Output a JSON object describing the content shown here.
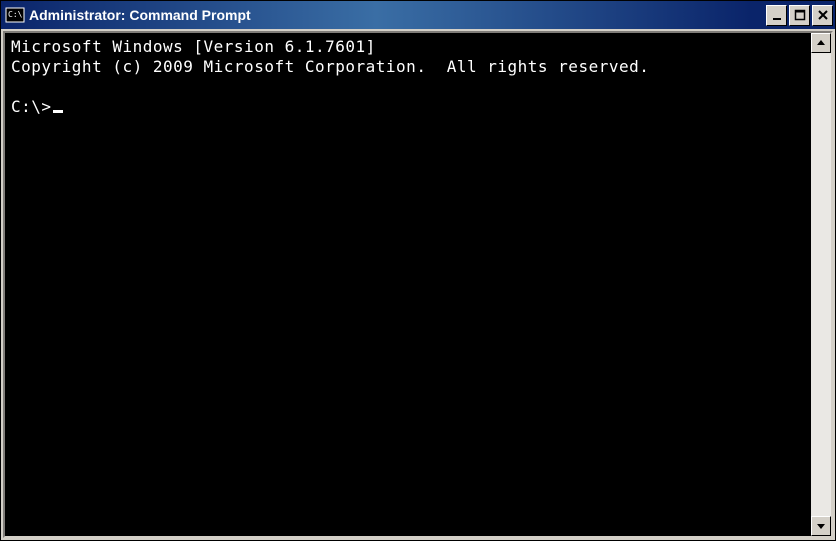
{
  "window": {
    "title": "Administrator: Command Prompt"
  },
  "terminal": {
    "line1": "Microsoft Windows [Version 6.1.7601]",
    "line2": "Copyright (c) 2009 Microsoft Corporation.  All rights reserved.",
    "blank": "",
    "prompt": "C:\\>"
  }
}
